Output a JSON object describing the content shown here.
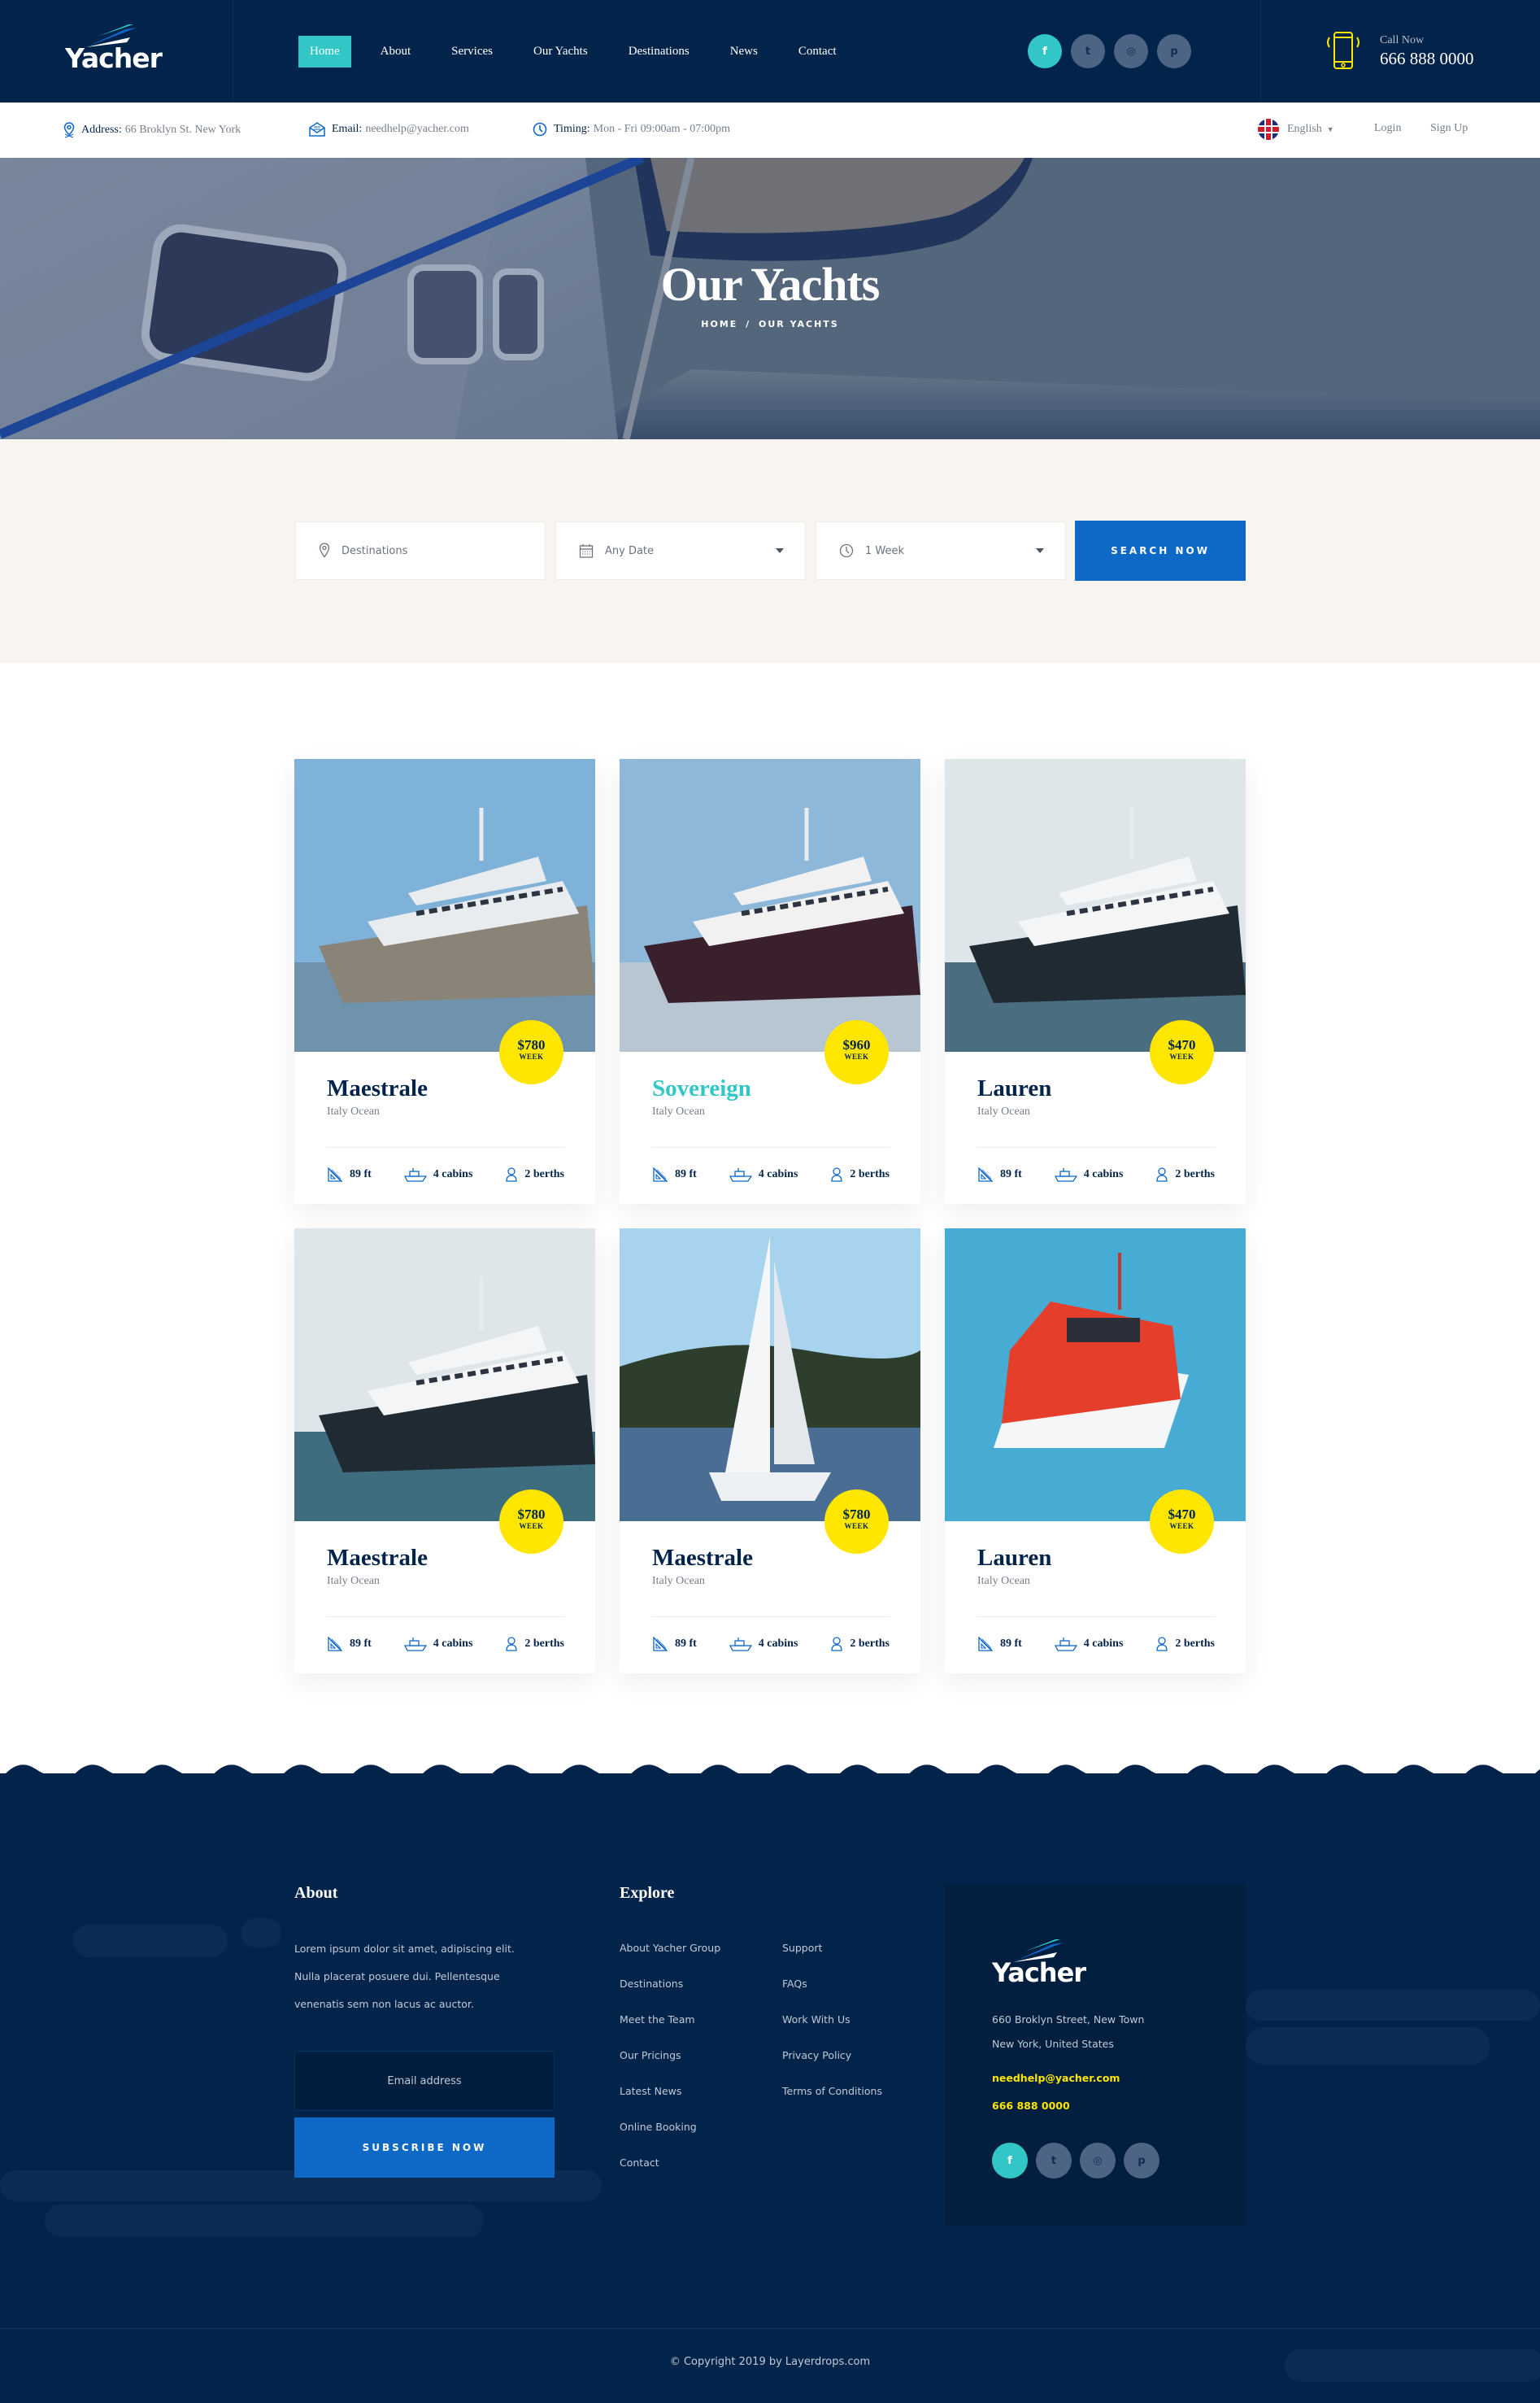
{
  "brand": {
    "name": "Yacher"
  },
  "nav": {
    "items": [
      {
        "label": "Home",
        "active": true
      },
      {
        "label": "About",
        "active": false
      },
      {
        "label": "Services",
        "active": false
      },
      {
        "label": "Our Yachts",
        "active": false
      },
      {
        "label": "Destinations",
        "active": false
      },
      {
        "label": "News",
        "active": false
      },
      {
        "label": "Contact",
        "active": false
      }
    ]
  },
  "social": [
    {
      "name": "facebook",
      "glyph": "f"
    },
    {
      "name": "twitter",
      "glyph": "t"
    },
    {
      "name": "instagram",
      "glyph": "◎"
    },
    {
      "name": "pinterest",
      "glyph": "p"
    }
  ],
  "call": {
    "label": "Call Now",
    "number": "666 888 0000"
  },
  "infobar": {
    "address_label": "Address:",
    "address": "66 Broklyn St. New York",
    "email_label": "Email:",
    "email": "needhelp@yacher.com",
    "timing_label": "Timing:",
    "timing": "Mon - Fri 09:00am - 07:00pm",
    "language": "English",
    "login": "Login",
    "signup": "Sign Up"
  },
  "hero": {
    "title": "Our Yachts",
    "breadcrumb": [
      "HOME",
      "/",
      "OUR YACHTS"
    ]
  },
  "search": {
    "destination_placeholder": "Destinations",
    "date_value": "Any Date",
    "duration_value": "1 Week",
    "button": "SEARCH NOW"
  },
  "yachts": [
    {
      "name": "Maestrale",
      "location": "Italy Ocean",
      "price": "$780",
      "period": "WEEK",
      "length": "89 ft",
      "cabins": "4 cabins",
      "berths": "2 berths",
      "highlight": false
    },
    {
      "name": "Sovereign",
      "location": "Italy Ocean",
      "price": "$960",
      "period": "WEEK",
      "length": "89 ft",
      "cabins": "4 cabins",
      "berths": "2 berths",
      "highlight": true
    },
    {
      "name": "Lauren",
      "location": "Italy Ocean",
      "price": "$470",
      "period": "WEEK",
      "length": "89 ft",
      "cabins": "4 cabins",
      "berths": "2 berths",
      "highlight": false
    },
    {
      "name": "Maestrale",
      "location": "Italy Ocean",
      "price": "$780",
      "period": "WEEK",
      "length": "89 ft",
      "cabins": "4 cabins",
      "berths": "2 berths",
      "highlight": false
    },
    {
      "name": "Maestrale",
      "location": "Italy Ocean",
      "price": "$780",
      "period": "WEEK",
      "length": "89 ft",
      "cabins": "4 cabins",
      "berths": "2 berths",
      "highlight": false
    },
    {
      "name": "Lauren",
      "location": "Italy Ocean",
      "price": "$470",
      "period": "WEEK",
      "length": "89 ft",
      "cabins": "4 cabins",
      "berths": "2 berths",
      "highlight": false
    }
  ],
  "footer": {
    "about_title": "About",
    "about_lines": [
      "Lorem ipsum dolor sit amet, adipiscing elit.",
      "Nulla placerat posuere dui. Pellentesque",
      "venenatis sem non lacus ac auctor."
    ],
    "email_placeholder": "Email address",
    "subscribe": "SUBSCRIBE NOW",
    "explore_title": "Explore",
    "explore_col1": [
      "About Yacher Group",
      "Destinations",
      "Meet the Team",
      "Our Pricings",
      "Latest News",
      "Online Booking",
      "Contact"
    ],
    "explore_col2": [
      "Support",
      "FAQs",
      "Work With Us",
      "Privacy Policy",
      "Terms of Conditions"
    ],
    "address_lines": [
      "660 Broklyn Street, New Town",
      "New York, United States"
    ],
    "email": "needhelp@yacher.com",
    "phone": "666 888 0000",
    "copyright": "© Copyright 2019 by Layerdrops.com"
  },
  "colors": {
    "navy": "#03244a",
    "teal": "#33c6c6",
    "blue": "#0e68c6",
    "yellow": "#ffe600",
    "sand": "#f8f5f0"
  }
}
